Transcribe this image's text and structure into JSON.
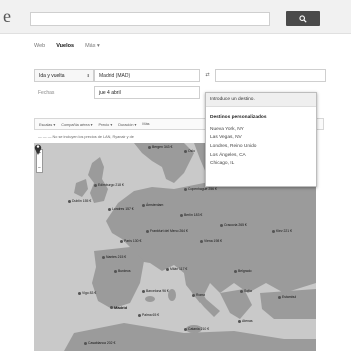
{
  "header": {
    "logo": "e"
  },
  "nav": {
    "tabs": [
      "Web",
      "Vuelos",
      "Más ▾"
    ],
    "active": 1
  },
  "form": {
    "trip_type": "Ida y vuelta",
    "origin": "Madrid (MAD)",
    "swap": "⇄",
    "dates_label": "Fechas",
    "date": "jue 4 abril"
  },
  "filters": [
    "Escalas ▾",
    "Compañía aérea ▾",
    "Precio ▾",
    "Duración ▾",
    "Más"
  ],
  "notice": "— — — No se incluyen los precios de LAN, Ryanair y de",
  "dropdown": {
    "intro": "Introduce un destino.",
    "heading": "Destinos personalizados",
    "items": [
      "Nueva York, NY",
      "Las Vegas, NV",
      "Londres, Reino Unido",
      "Los Ángeles, CA",
      "Chicago, IL"
    ]
  },
  "map": {
    "zoom_plus": "+",
    "zoom_minus": "−",
    "prices": [
      {
        "label": "Bergen 343 €"
      },
      {
        "label": "Oslo"
      },
      {
        "label": "Edimburgo 218 €"
      },
      {
        "label": "Copenhague 256 €"
      },
      {
        "label": "Dublín 155 €"
      },
      {
        "label": "Londres 157 €"
      },
      {
        "label": "Ámsterdam"
      },
      {
        "label": "Berlín 183 €"
      },
      {
        "label": "París 130 €"
      },
      {
        "label": "Frankfurt del Meno 264 €"
      },
      {
        "label": "Cracovia 265 €"
      },
      {
        "label": "Kiev 221 €"
      },
      {
        "label": "Viena 198 €"
      },
      {
        "label": "Nantes 215 €"
      },
      {
        "label": "Burdeos"
      },
      {
        "label": "Milán 117 €"
      },
      {
        "label": "Belgrado"
      },
      {
        "label": "Vigo 83 €"
      },
      {
        "label": "Barcelona 96 €"
      },
      {
        "label": "Roma"
      },
      {
        "label": "Sofía"
      },
      {
        "label": "Estambul"
      },
      {
        "label": "Atenas"
      },
      {
        "label": "Madrid"
      },
      {
        "label": "Catania 210 €"
      },
      {
        "label": "Palma 65 €"
      },
      {
        "label": "Casablanca 202 €"
      }
    ]
  }
}
